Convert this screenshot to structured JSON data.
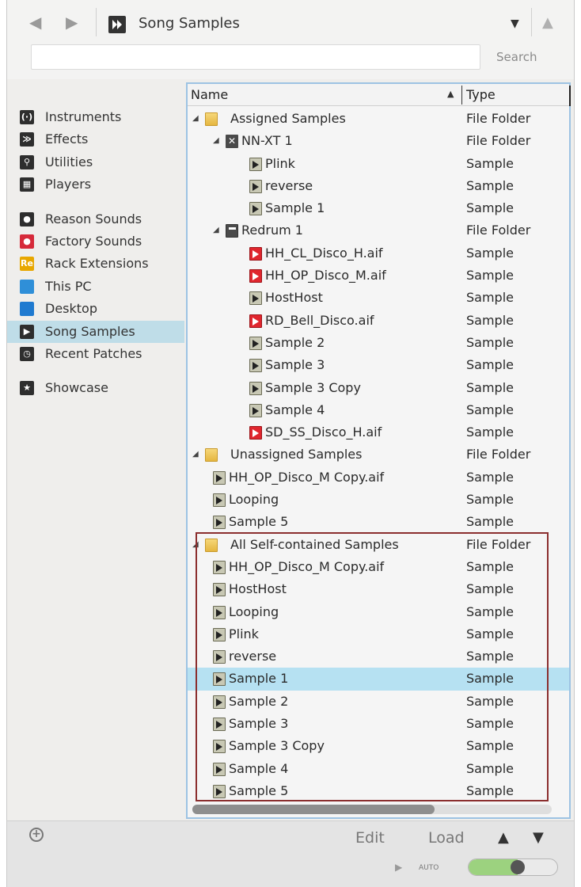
{
  "location": {
    "title": "Song Samples",
    "icon": "song-samples-icon",
    "back_icon": "◀",
    "forward_icon": "▶",
    "dropdown_icon": "▼",
    "up_icon": "▲"
  },
  "search": {
    "value": "",
    "placeholder": "",
    "button_label": "Search"
  },
  "sidebar": {
    "items": [
      {
        "label": "Instruments",
        "icon": "instruments-icon",
        "glyph": "(·)"
      },
      {
        "label": "Effects",
        "icon": "effects-icon",
        "glyph": "≫"
      },
      {
        "label": "Utilities",
        "icon": "utilities-icon",
        "glyph": "⚲"
      },
      {
        "label": "Players",
        "icon": "players-icon",
        "glyph": "▦"
      },
      {
        "label": "Reason Sounds",
        "icon": "reason-sounds-icon",
        "glyph": "●"
      },
      {
        "label": "Factory Sounds",
        "icon": "factory-sounds-icon",
        "glyph": "●"
      },
      {
        "label": "Rack Extensions",
        "icon": "rack-extensions-icon",
        "glyph": "Re"
      },
      {
        "label": "This PC",
        "icon": "this-pc-icon",
        "glyph": ""
      },
      {
        "label": "Desktop",
        "icon": "desktop-icon",
        "glyph": ""
      },
      {
        "label": "Song Samples",
        "icon": "song-samples-icon",
        "glyph": "▶"
      },
      {
        "label": "Recent Patches",
        "icon": "recent-patches-icon",
        "glyph": "◷"
      },
      {
        "label": "Showcase",
        "icon": "showcase-icon",
        "glyph": "★"
      }
    ],
    "selected_index": 9
  },
  "file_list": {
    "columns": {
      "name": "Name",
      "type": "Type"
    },
    "sort_arrow": "▲",
    "rows": [
      {
        "name": "Assigned Samples",
        "type": "File Folder",
        "kind": "folder",
        "level": 0,
        "expander": "◢"
      },
      {
        "name": "NN-XT 1",
        "type": "File Folder",
        "kind": "nnxt",
        "level": 1,
        "expander": "◢"
      },
      {
        "name": "Plink",
        "type": "Sample",
        "kind": "sample",
        "level": 2
      },
      {
        "name": "reverse",
        "type": "Sample",
        "kind": "sample",
        "level": 2
      },
      {
        "name": "Sample 1",
        "type": "Sample",
        "kind": "sample",
        "level": 2
      },
      {
        "name": "Redrum 1",
        "type": "File Folder",
        "kind": "redrum",
        "level": 1,
        "expander": "◢"
      },
      {
        "name": "HH_CL_Disco_H.aif",
        "type": "Sample",
        "kind": "aif",
        "level": 2
      },
      {
        "name": "HH_OP_Disco_M.aif",
        "type": "Sample",
        "kind": "aif",
        "level": 2
      },
      {
        "name": "HostHost",
        "type": "Sample",
        "kind": "sample",
        "level": 2
      },
      {
        "name": "RD_Bell_Disco.aif",
        "type": "Sample",
        "kind": "aif",
        "level": 2
      },
      {
        "name": "Sample 2",
        "type": "Sample",
        "kind": "sample",
        "level": 2
      },
      {
        "name": "Sample 3",
        "type": "Sample",
        "kind": "sample",
        "level": 2
      },
      {
        "name": "Sample 3 Copy",
        "type": "Sample",
        "kind": "sample",
        "level": 2
      },
      {
        "name": "Sample 4",
        "type": "Sample",
        "kind": "sample",
        "level": 2
      },
      {
        "name": "SD_SS_Disco_H.aif",
        "type": "Sample",
        "kind": "aif",
        "level": 2
      },
      {
        "name": "Unassigned Samples",
        "type": "File Folder",
        "kind": "folder",
        "level": 0,
        "expander": "◢"
      },
      {
        "name": "HH_OP_Disco_M Copy.aif",
        "type": "Sample",
        "kind": "sample",
        "level": 1
      },
      {
        "name": "Looping",
        "type": "Sample",
        "kind": "sample",
        "level": 1
      },
      {
        "name": "Sample 5",
        "type": "Sample",
        "kind": "sample",
        "level": 1
      },
      {
        "name": "All Self-contained Samples",
        "type": "File Folder",
        "kind": "folder",
        "level": 0,
        "expander": "◢"
      },
      {
        "name": "HH_OP_Disco_M Copy.aif",
        "type": "Sample",
        "kind": "sample",
        "level": 1
      },
      {
        "name": "HostHost",
        "type": "Sample",
        "kind": "sample",
        "level": 1
      },
      {
        "name": "Looping",
        "type": "Sample",
        "kind": "sample",
        "level": 1
      },
      {
        "name": "Plink",
        "type": "Sample",
        "kind": "sample",
        "level": 1
      },
      {
        "name": "reverse",
        "type": "Sample",
        "kind": "sample",
        "level": 1
      },
      {
        "name": "Sample 1",
        "type": "Sample",
        "kind": "sample",
        "level": 1,
        "selected": true
      },
      {
        "name": "Sample 2",
        "type": "Sample",
        "kind": "sample",
        "level": 1
      },
      {
        "name": "Sample 3",
        "type": "Sample",
        "kind": "sample",
        "level": 1
      },
      {
        "name": "Sample 3 Copy",
        "type": "Sample",
        "kind": "sample",
        "level": 1
      },
      {
        "name": "Sample 4",
        "type": "Sample",
        "kind": "sample",
        "level": 1
      },
      {
        "name": "Sample 5",
        "type": "Sample",
        "kind": "sample",
        "level": 1
      }
    ]
  },
  "bottom": {
    "add_icon": "+",
    "edit_label": "Edit",
    "load_label": "Load",
    "prev_icon": "▲",
    "next_icon": "▼",
    "play_icon": "▶",
    "auto_label": "AUTO",
    "auto_toggle_level": 0.55
  },
  "colors": {
    "selection": "#b6e1f2",
    "sidebar_selection": "#bfdde8",
    "highlight_box": "#8b2e2e",
    "toggle_on": "#9cd27f",
    "panel_border": "#9dc3e3"
  }
}
